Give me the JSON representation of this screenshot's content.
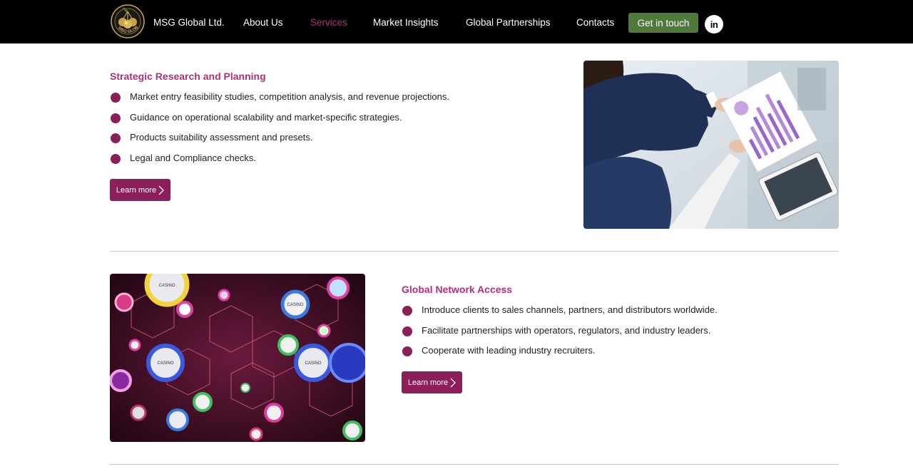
{
  "header": {
    "brand": "MSG Global Ltd.",
    "logo_text": "MSG GLOBAL",
    "nav": [
      {
        "label": "About Us",
        "active": false
      },
      {
        "label": "Services",
        "active": true
      },
      {
        "label": "Market Insights",
        "active": false
      },
      {
        "label": "Global Partnerships",
        "active": false
      },
      {
        "label": "Contacts",
        "active": false
      }
    ],
    "cta_label": "Get in touch",
    "social_icon": "linkedin-icon",
    "social_label": "in"
  },
  "sections": [
    {
      "title": "Strategic Research and Planning",
      "bullets": [
        "Market entry feasibility studies, competition analysis, and revenue projections.",
        "Guidance on operational scalability and market-specific strategies.",
        "Products suitability assessment and presets.",
        "Legal and Compliance checks."
      ],
      "button_label": "Learn more",
      "image_icon": "business-meeting-photo"
    },
    {
      "title": "Global Network Access",
      "bullets": [
        "Introduce clients to sales channels, partners, and distributors worldwide.",
        "Facilitate partnerships with operators, regulators, and industry leaders.",
        "Cooperate with leading industry recruiters."
      ],
      "button_label": "Learn more",
      "image_icon": "casino-chips-photo",
      "chip_label": "CASINO"
    }
  ],
  "colors": {
    "header_bg": "#000000",
    "accent": "#b0307a",
    "button": "#8c1e5a",
    "cta": "#4f7a3c"
  }
}
